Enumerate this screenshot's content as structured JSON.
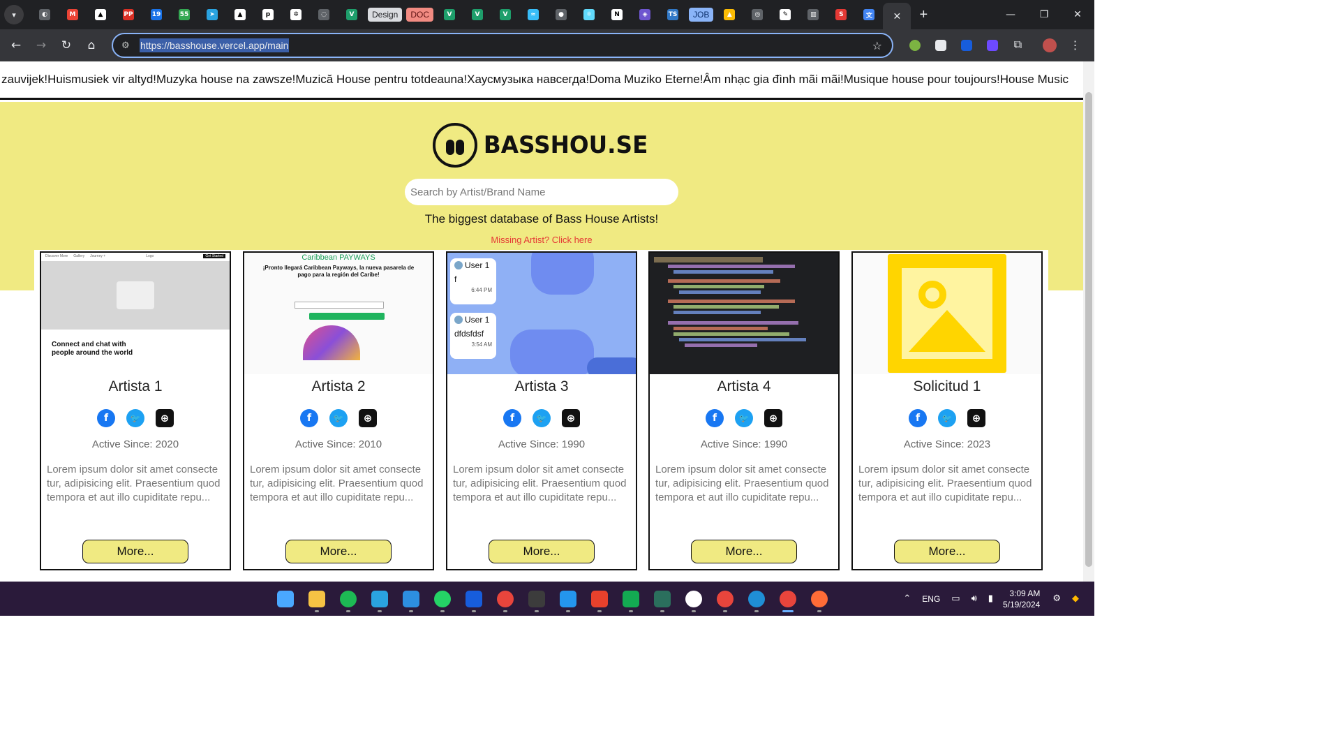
{
  "browser": {
    "tabs": [
      {
        "icon": "generic-globe-icon",
        "color": "#5f6368",
        "glyph": "◐"
      },
      {
        "icon": "gmail-icon",
        "color": "#ea4335",
        "glyph": "M"
      },
      {
        "icon": "triangle-icon",
        "color": "#000000",
        "glyph": "▲"
      },
      {
        "icon": "pp-icon",
        "color": "#d93025",
        "glyph": "PP"
      },
      {
        "icon": "calendar-icon",
        "color": "#1a73e8",
        "glyph": "19"
      },
      {
        "icon": "chat-icon",
        "color": "#34a853",
        "glyph": "55"
      },
      {
        "icon": "telegram-icon",
        "color": "#2aa3e0",
        "glyph": "➤"
      },
      {
        "icon": "triangle-icon",
        "color": "#000000",
        "glyph": "▲"
      },
      {
        "icon": "p-icon",
        "color": "#000000",
        "glyph": "p"
      },
      {
        "icon": "openai-icon",
        "color": "#000000",
        "glyph": "✲"
      },
      {
        "icon": "loader-icon",
        "color": "#5f6368",
        "glyph": "◌"
      },
      {
        "icon": "v-icon",
        "color": "#1e9e6b",
        "glyph": "V"
      }
    ],
    "tab_pill_design": "Design",
    "tab_pill_doc": "DOC",
    "tabs_after": [
      {
        "icon": "v-icon",
        "color": "#1e9e6b",
        "glyph": "V"
      },
      {
        "icon": "v-icon",
        "color": "#1e9e6b",
        "glyph": "V"
      },
      {
        "icon": "v-icon",
        "color": "#1e9e6b",
        "glyph": "V"
      },
      {
        "icon": "tailwind-icon",
        "color": "#38bdf8",
        "glyph": "≈"
      },
      {
        "icon": "person-icon",
        "color": "#5f6368",
        "glyph": "●"
      },
      {
        "icon": "react-icon",
        "color": "#61dafb",
        "glyph": "⚛"
      },
      {
        "icon": "n-icon",
        "color": "#000000",
        "glyph": "N"
      },
      {
        "icon": "shield-icon",
        "color": "#6e56cf",
        "glyph": "◈"
      },
      {
        "icon": "ts-icon",
        "color": "#3178c6",
        "glyph": "TS"
      }
    ],
    "tab_pill_job": "JOB",
    "tabs_end": [
      {
        "icon": "drive-icon",
        "color": "#fbbc04",
        "glyph": "▲"
      },
      {
        "icon": "settings-icon",
        "color": "#5f6368",
        "glyph": "◎"
      },
      {
        "icon": "link-icon",
        "color": "#ffffff",
        "glyph": "✎"
      },
      {
        "icon": "chart-icon",
        "color": "#5f6368",
        "glyph": "▥"
      },
      {
        "icon": "s-icon",
        "color": "#e53935",
        "glyph": "S"
      },
      {
        "icon": "translate-icon",
        "color": "#4285f4",
        "glyph": "文"
      }
    ],
    "address_url": "https://basshouse.vercel.app/main"
  },
  "page": {
    "marquee_text": "zauvijek!Huismusiek vir altyd!Muzyka house na zawsze!Muzică House pentru totdeauna!Хаусмузыка навсегда!Doma Muziko Eterne!Âm nhạc gia đình mãi mãi!Musique house pour toujours!House Music",
    "logo_text": "BASSHOU.SE",
    "search_placeholder": "Search by Artist/Brand Name",
    "tagline": "The biggest database of Bass House Artists!",
    "missing_link": "Missing Artist? Click here",
    "more_label": "More...",
    "description": "Lorem ipsum dolor sit amet consecte tur, adipisicing elit. Praesentium quod tempora et aut illo cupiditate repu...",
    "cards": [
      {
        "name": "Artista 1",
        "since": "Active Since: 2020"
      },
      {
        "name": "Artista 2",
        "since": "Active Since: 2010"
      },
      {
        "name": "Artista 3",
        "since": "Active Since: 1990"
      },
      {
        "name": "Artista 4",
        "since": "Active Since: 1990"
      },
      {
        "name": "Solicitud 1",
        "since": "Active Since: 2023"
      }
    ],
    "thumb1": {
      "nav": [
        "Discover More",
        "Gallery",
        "Journey +"
      ],
      "logo": "Logo",
      "cta": "Get Started",
      "headline": "Connect and chat with people around the world"
    },
    "thumb2": {
      "brand": "Caribbean PAYWAYS",
      "headline": "¡Pronto llegará Caribbean Payways, la nueva pasarela de pago para la región del Caribe!"
    },
    "thumb3": {
      "msg1_user": "User 1",
      "msg1_text": "f",
      "msg1_time": "6:44 PM",
      "msg2_user": "User 1",
      "msg2_text": "dfdsfdsf",
      "msg2_time": "3:54 AM"
    },
    "accent_color": "#f0ea82",
    "link_color": "#e53935"
  },
  "taskbar": {
    "apps": [
      {
        "icon": "windows-start-icon",
        "color": "#4aa8ff"
      },
      {
        "icon": "file-explorer-icon",
        "color": "#f6c244"
      },
      {
        "icon": "spotify-icon",
        "color": "#1db954"
      },
      {
        "icon": "telegram-icon",
        "color": "#2aa3e0"
      },
      {
        "icon": "vscode-icon",
        "color": "#2d8fe0"
      },
      {
        "icon": "whatsapp-icon",
        "color": "#25d366"
      },
      {
        "icon": "bitwarden-icon",
        "color": "#175ddc"
      },
      {
        "icon": "chrome-icon",
        "color": "#e8453c"
      },
      {
        "icon": "terminal-icon",
        "color": "#3c3c3c"
      },
      {
        "icon": "docker-icon",
        "color": "#2496ed"
      },
      {
        "icon": "wps-icon",
        "color": "#e8412c"
      },
      {
        "icon": "mongodb-icon",
        "color": "#13aa52"
      },
      {
        "icon": "compass-icon",
        "color": "#2b6f5d"
      },
      {
        "icon": "media-player-icon",
        "color": "#ffffff"
      },
      {
        "icon": "chrome-profile-icon",
        "color": "#e8453c"
      },
      {
        "icon": "edge-icon",
        "color": "#1f8fd6"
      },
      {
        "icon": "chrome-active-icon",
        "color": "#e8453c"
      },
      {
        "icon": "postman-icon",
        "color": "#ff6c37"
      }
    ],
    "language": "ENG",
    "time": "3:09 AM",
    "date": "5/19/2024"
  }
}
